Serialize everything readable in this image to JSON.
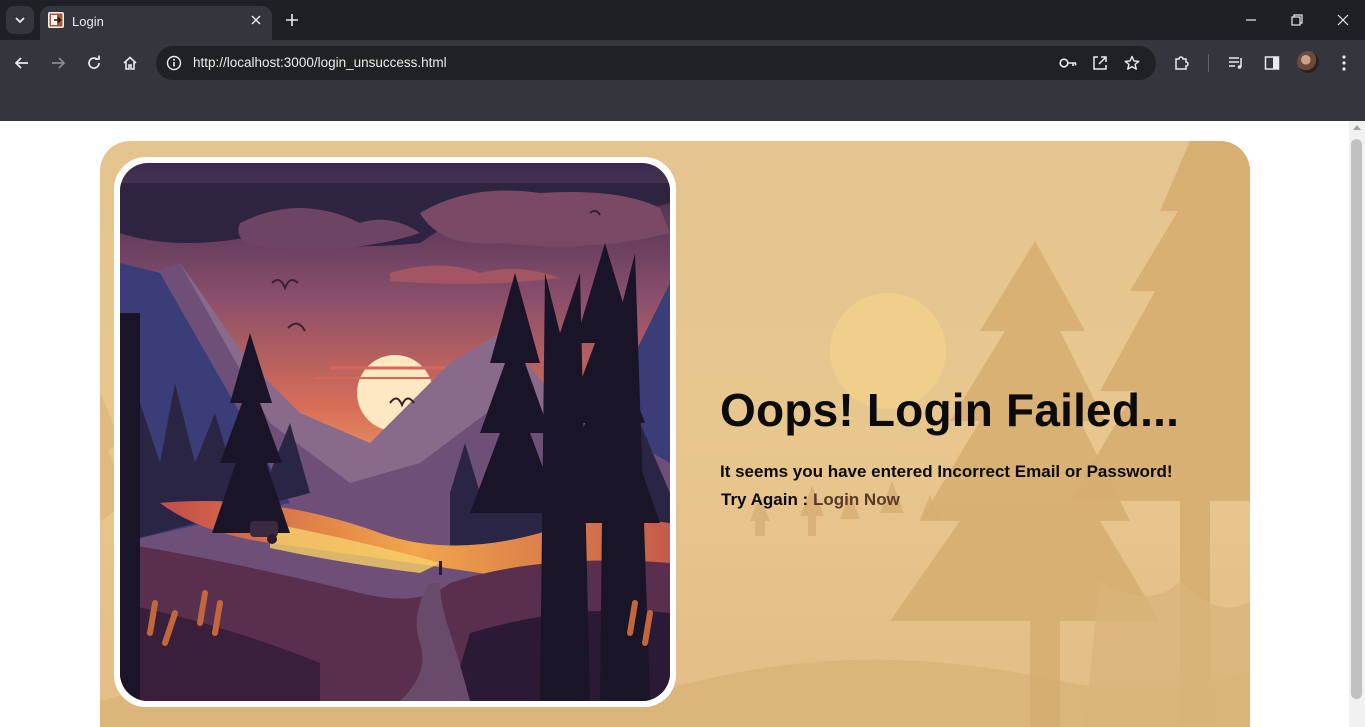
{
  "browser": {
    "tab_title": "Login",
    "url": "http://localhost:3000/login_unsuccess.html"
  },
  "page": {
    "heading": "Oops! Login Failed...",
    "subtext": "It seems you have entered Incorrect Email or Password!",
    "retry_prefix": "Try Again : ",
    "retry_link": "Login Now"
  },
  "colors": {
    "card_background": "#e4c48f",
    "link": "#5a3a2a",
    "chrome_dark": "#1f2026",
    "chrome_toolbar": "#35363d"
  },
  "icons": {
    "tab_list": "chevron-down-icon",
    "favicon": "login-favicon-icon",
    "tab_close": "close-icon",
    "new_tab": "plus-icon",
    "back": "arrow-left-icon",
    "forward": "arrow-right-icon",
    "reload": "reload-icon",
    "home": "home-icon",
    "site_info": "info-icon",
    "password": "key-icon",
    "open_in_app": "open-external-icon",
    "bookmark": "star-icon",
    "extensions": "puzzle-icon",
    "media": "media-queue-icon",
    "side_panel": "side-panel-icon",
    "menu": "kebab-menu-icon"
  }
}
